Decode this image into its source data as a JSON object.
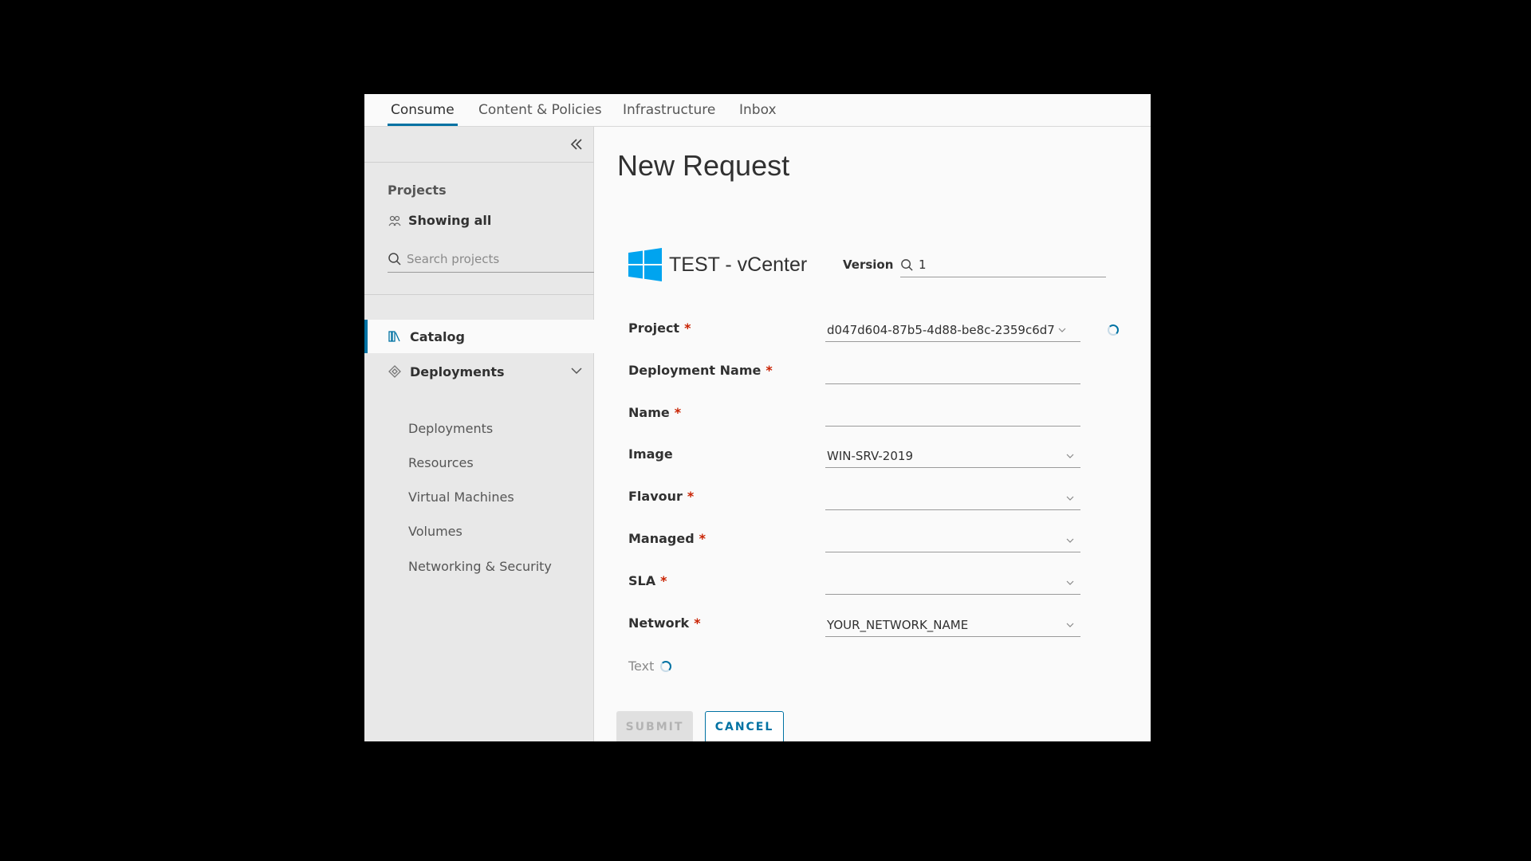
{
  "nav": {
    "tabs": [
      {
        "label": "Consume"
      },
      {
        "label": "Content & Policies"
      },
      {
        "label": "Infrastructure"
      },
      {
        "label": "Inbox"
      }
    ],
    "active": "Consume"
  },
  "sidebar": {
    "projects_label": "Projects",
    "showing_all": "Showing all",
    "search_placeholder": "Search projects",
    "catalog": "Catalog",
    "deployments_header": "Deployments",
    "sub_items": [
      "Deployments",
      "Resources",
      "Virtual Machines",
      "Volumes",
      "Networking & Security"
    ]
  },
  "main": {
    "title": "New Request",
    "item_name": "TEST - vCenter",
    "version_label": "Version",
    "version_value": "1",
    "required_mark": "*",
    "fields": {
      "project": {
        "label": "Project",
        "value": "d047d604-87b5-4d88-be8c-2359c6d7"
      },
      "deployment_name": {
        "label": "Deployment Name",
        "value": ""
      },
      "name": {
        "label": "Name",
        "value": ""
      },
      "image": {
        "label": "Image",
        "value": "WIN-SRV-2019"
      },
      "flavour": {
        "label": "Flavour",
        "value": ""
      },
      "managed": {
        "label": "Managed",
        "value": ""
      },
      "sla": {
        "label": "SLA",
        "value": ""
      },
      "network": {
        "label": "Network",
        "value": "YOUR_NETWORK_NAME"
      }
    },
    "text_label": "Text",
    "submit": "SUBMIT",
    "cancel": "CANCEL"
  },
  "colors": {
    "accent": "#0072a3",
    "required": "#c92100",
    "windows_blue": "#00a4ef"
  },
  "icons": [
    "double-chevron-left-icon",
    "users-icon",
    "search-icon",
    "catalog-icon",
    "deployments-icon",
    "chevron-down-icon",
    "windows-logo-icon",
    "spinner-icon"
  ]
}
